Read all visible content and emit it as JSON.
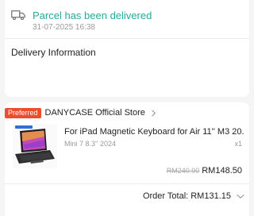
{
  "status": {
    "title": "Parcel has been delivered",
    "timestamp": "31-07-2025 16:38",
    "icon": "truck-icon",
    "color": "#26aa99"
  },
  "delivery": {
    "section_title": "Delivery Information"
  },
  "shop": {
    "badge": "Preferred",
    "badge_color": "#ee4d2d",
    "name": "DANYCASE Official Store"
  },
  "product": {
    "title": "For iPad Magnetic Keyboard for Air 11'' M3 20...",
    "variant": "Mini 7 8.3'' 2024",
    "quantity": "x1",
    "original_price": "RM240.90",
    "price": "RM148.50"
  },
  "order": {
    "total_label": "Order Total:",
    "total_value": "RM131.15"
  }
}
